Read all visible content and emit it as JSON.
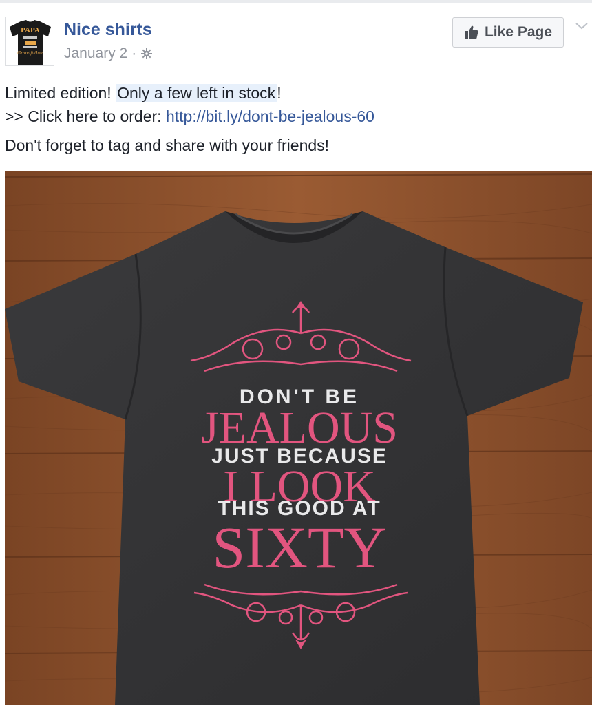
{
  "post": {
    "page_name": "Nice shirts",
    "date": "January 2",
    "separator": "·",
    "privacy_icon": "gear-icon",
    "like_button_label": "Like Page",
    "avatar_text": {
      "line1": "PAPA",
      "line2": "Grandfather"
    },
    "text": {
      "line1_prefix": "Limited edition! ",
      "line1_highlight": "Only a few left in stock",
      "line1_suffix": "!",
      "line2_prefix": ">> Click here to order: ",
      "line2_link": "http://bit.ly/dont-be-jealous-60",
      "line3": "Don't forget to tag and share with your friends!"
    },
    "shirt": {
      "line1": "DON'T BE",
      "line2": "JEALOUS",
      "line3": "JUST BECAUSE",
      "line4": "I LOOK",
      "line5": "THIS GOOD AT",
      "line6": "SIXTY"
    }
  },
  "colors": {
    "link": "#365899",
    "pink": "#e2557f",
    "shirt": "#343436",
    "wood": "#8a4f2b"
  }
}
